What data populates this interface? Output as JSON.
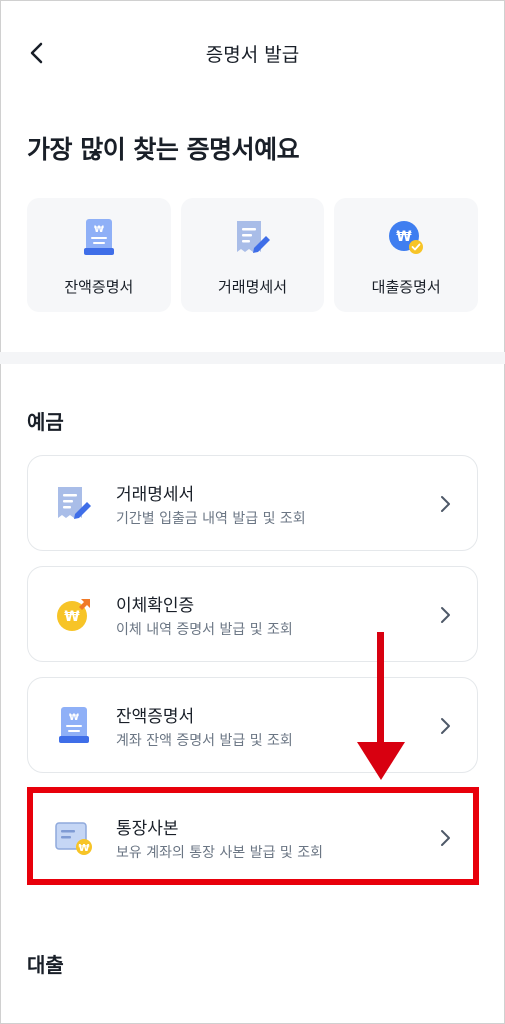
{
  "header": {
    "title": "증명서 발급",
    "back_icon": "chevron-left-icon"
  },
  "popular": {
    "heading": "가장 많이 찾는 증명서예요",
    "items": [
      {
        "label": "잔액증명서",
        "icon": "balance-document-icon"
      },
      {
        "label": "거래명세서",
        "icon": "transaction-statement-icon"
      },
      {
        "label": "대출증명서",
        "icon": "loan-certificate-icon"
      }
    ]
  },
  "deposit": {
    "heading": "예금",
    "items": [
      {
        "title": "거래명세서",
        "desc": "기간별 입출금 내역 발급 및 조회",
        "icon": "transaction-statement-icon"
      },
      {
        "title": "이체확인증",
        "desc": "이체 내역 증명서 발급 및 조회",
        "icon": "transfer-confirmation-icon"
      },
      {
        "title": "잔액증명서",
        "desc": "계좌 잔액 증명서 발급 및 조회",
        "icon": "balance-document-icon"
      },
      {
        "title": "통장사본",
        "desc": "보유 계좌의 통장 사본 발급 및 조회",
        "icon": "bankbook-copy-icon"
      }
    ]
  },
  "loan": {
    "heading": "대출"
  },
  "colors": {
    "highlight": "#e8000b",
    "arrow": "#d80010",
    "icon_blue": "#4d7cf5",
    "icon_yellow": "#f7c427"
  }
}
